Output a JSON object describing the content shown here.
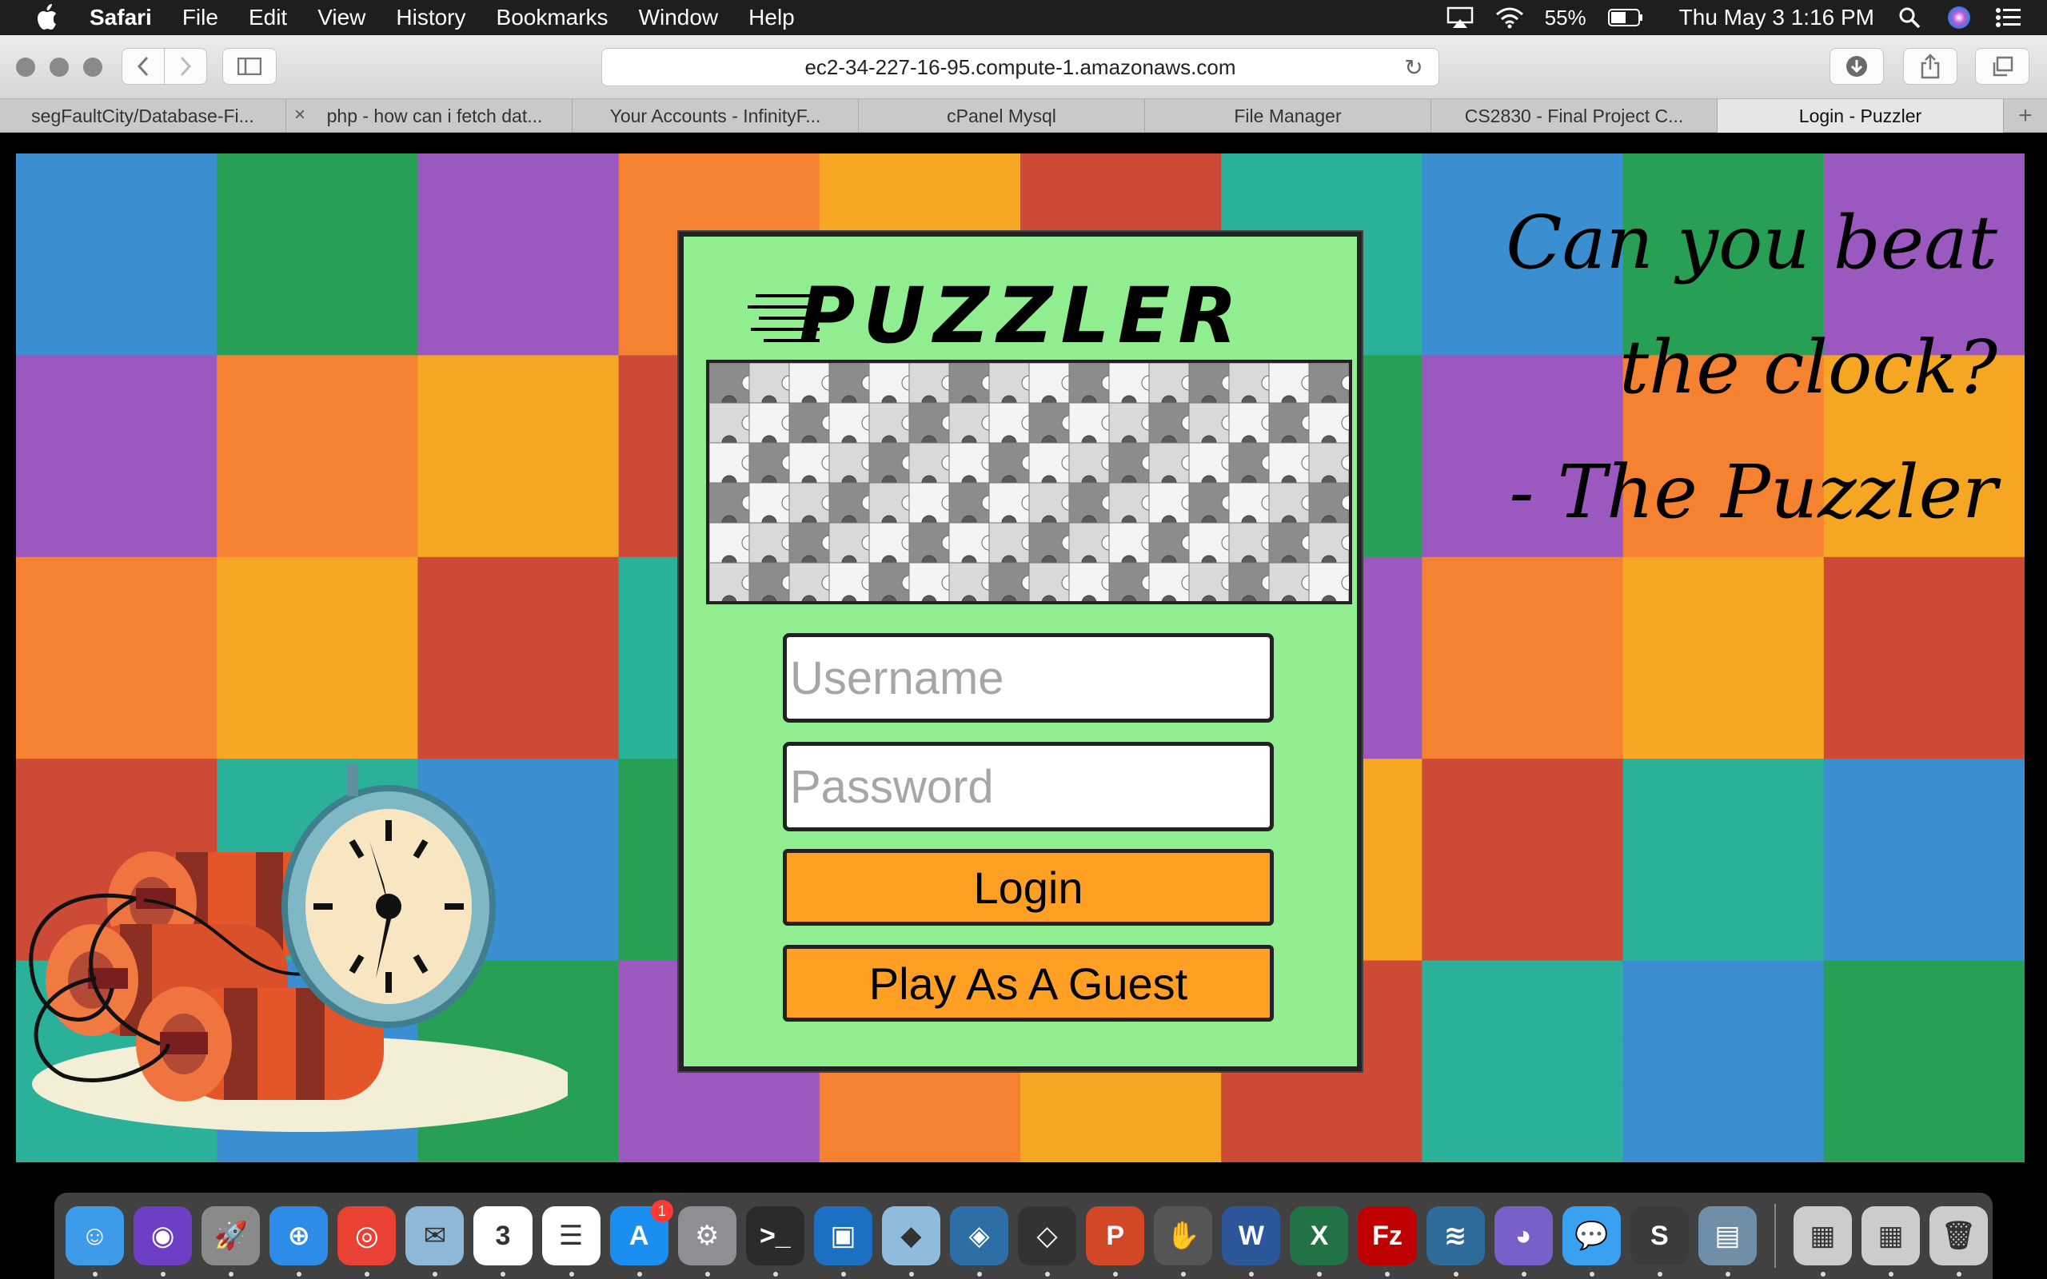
{
  "menubar": {
    "app_name": "Safari",
    "menus": [
      "File",
      "Edit",
      "View",
      "History",
      "Bookmarks",
      "Window",
      "Help"
    ],
    "battery": "55%",
    "clock": "Thu May 3  1:16 PM"
  },
  "toolbar": {
    "url": "ec2-34-227-16-95.compute-1.amazonaws.com"
  },
  "tabs": [
    {
      "label": "segFaultCity/Database-Fi...",
      "closable": false
    },
    {
      "label": "php - how can i fetch dat...",
      "closable": true
    },
    {
      "label": "Your Accounts - InfinityF...",
      "closable": false
    },
    {
      "label": "cPanel Mysql",
      "closable": false
    },
    {
      "label": "File Manager",
      "closable": false
    },
    {
      "label": "CS2830 - Final Project C...",
      "closable": false
    },
    {
      "label": "Login - Puzzler",
      "closable": false,
      "active": true
    }
  ],
  "page": {
    "logo_text": "PUZZLER",
    "username_placeholder": "Username",
    "password_placeholder": "Password",
    "login_label": "Login",
    "guest_label": "Play As A Guest",
    "quote_lines": [
      "Can you beat",
      "the clock?",
      "- The Puzzler"
    ]
  },
  "colors": {
    "panel": "#90ee90",
    "button": "#ffa024",
    "tile_palette": [
      "#3b8fd0",
      "#f5a623",
      "#27a055",
      "#cd4b36",
      "#9b59c0",
      "#2bb09a",
      "#f58230"
    ]
  },
  "dock": {
    "items": [
      {
        "name": "finder-icon",
        "glyph": "☺",
        "color": "#3d9be9"
      },
      {
        "name": "siri-icon",
        "glyph": "◉",
        "color": "#6d3fc4"
      },
      {
        "name": "launchpad-icon",
        "glyph": "🚀",
        "color": "#8a8a8a"
      },
      {
        "name": "safari-icon",
        "glyph": "⊕",
        "color": "#2c8ce8"
      },
      {
        "name": "chrome-icon",
        "glyph": "◎",
        "color": "#e94235"
      },
      {
        "name": "mail-icon",
        "glyph": "✉",
        "color": "#8fb8d8"
      },
      {
        "name": "calendar-icon",
        "glyph": "3",
        "color": "#ffffff"
      },
      {
        "name": "reminders-icon",
        "glyph": "☰",
        "color": "#ffffff"
      },
      {
        "name": "app-store-icon",
        "glyph": "A",
        "color": "#1b8ef2",
        "badge": "1"
      },
      {
        "name": "system-preferences-icon",
        "glyph": "⚙",
        "color": "#8e8e93"
      },
      {
        "name": "terminal-icon",
        "glyph": ">_",
        "color": "#2b2b2b"
      },
      {
        "name": "window-app-icon",
        "glyph": "▣",
        "color": "#1c6fc2"
      },
      {
        "name": "cube-app-icon",
        "glyph": "◆",
        "color": "#8fbcdc"
      },
      {
        "name": "virtualbox-icon",
        "glyph": "◈",
        "color": "#2e6ea6"
      },
      {
        "name": "unity-icon",
        "glyph": "◇",
        "color": "#333333"
      },
      {
        "name": "powerpoint-icon",
        "glyph": "P",
        "color": "#d24726"
      },
      {
        "name": "gesture-app-icon",
        "glyph": "✋",
        "color": "#555555"
      },
      {
        "name": "word-icon",
        "glyph": "W",
        "color": "#2b579a"
      },
      {
        "name": "excel-icon",
        "glyph": "X",
        "color": "#217346"
      },
      {
        "name": "filezilla-icon",
        "glyph": "Fz",
        "color": "#bf0000"
      },
      {
        "name": "mysql-workbench-icon",
        "glyph": "≋",
        "color": "#2f6b99"
      },
      {
        "name": "github-desktop-icon",
        "glyph": "◕",
        "color": "#7b5fc9"
      },
      {
        "name": "messages-icon",
        "glyph": "💬",
        "color": "#3aa0f0"
      },
      {
        "name": "sublime-text-icon",
        "glyph": "S",
        "color": "#3b3b3b"
      },
      {
        "name": "preview-icon",
        "glyph": "▤",
        "color": "#6f8fa8"
      }
    ],
    "right_items": [
      {
        "name": "filezilla-doc-icon",
        "glyph": "▦",
        "color": "#cccccc"
      },
      {
        "name": "chrome-doc-icon",
        "glyph": "▦",
        "color": "#cccccc"
      },
      {
        "name": "trash-icon",
        "glyph": "🗑",
        "color": "#cccccc"
      }
    ]
  }
}
